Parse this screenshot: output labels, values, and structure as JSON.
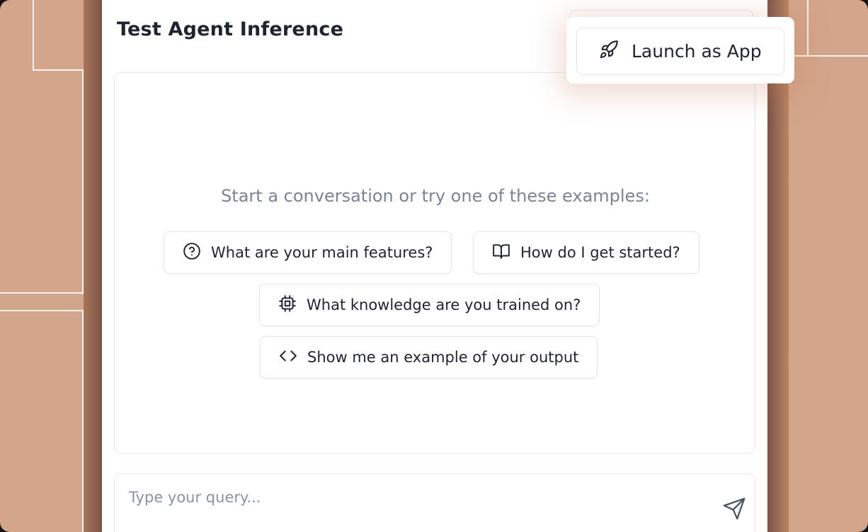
{
  "panel": {
    "title": "Test Agent Inference"
  },
  "chat": {
    "empty_prompt": "Start a conversation or try one of these examples:",
    "suggestions": [
      {
        "label": "What are your main features?",
        "icon": "question-circle-icon"
      },
      {
        "label": "How do I get started?",
        "icon": "book-open-icon"
      },
      {
        "label": "What knowledge are you trained on?",
        "icon": "cpu-chip-icon"
      },
      {
        "label": "Show me an example of your output",
        "icon": "code-brackets-icon"
      }
    ]
  },
  "input": {
    "placeholder": "Type your query...",
    "value": "",
    "send_icon": "send-icon"
  },
  "launch": {
    "label": "Launch as App",
    "icon": "rocket-icon"
  },
  "colors": {
    "background": "#d3a58a",
    "panel": "#ffffff",
    "text": "#1f2430",
    "muted": "#7b8494"
  }
}
